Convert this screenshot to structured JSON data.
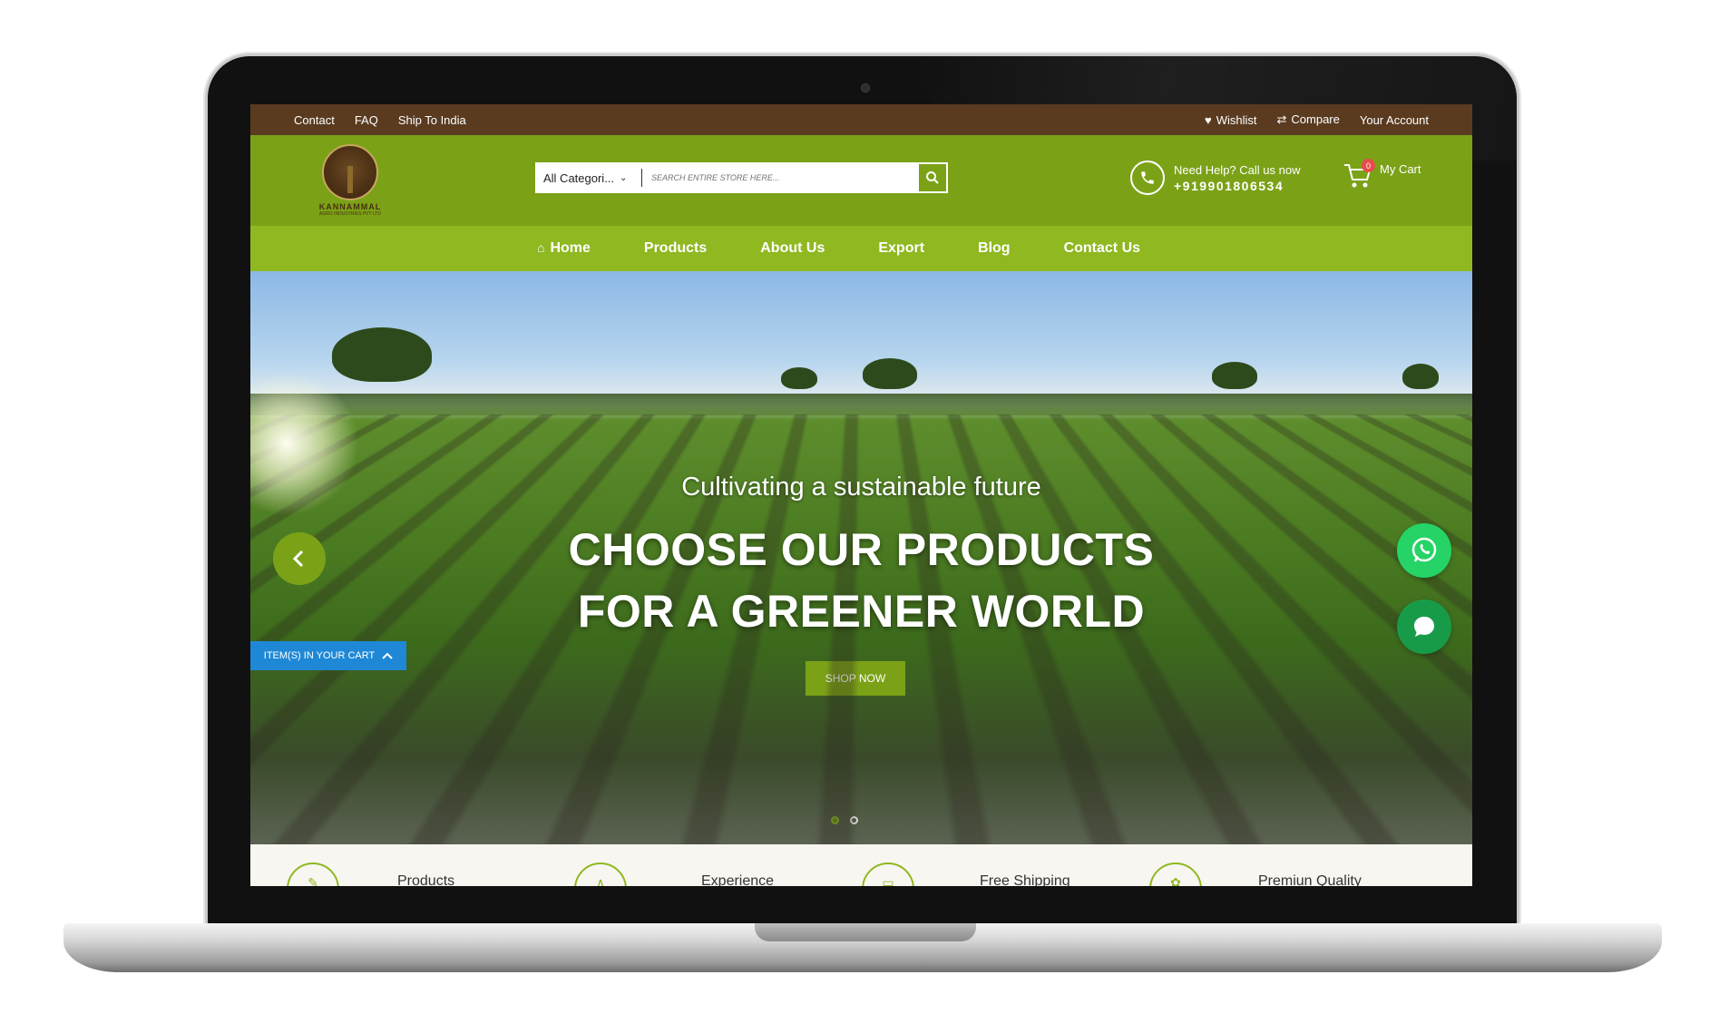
{
  "topbar": {
    "links": [
      "Contact",
      "FAQ",
      "Ship To India"
    ],
    "wishlist": "Wishlist",
    "compare": "Compare",
    "account": "Your Account"
  },
  "brand": {
    "name": "KANNAMMAL",
    "tagline": "AGRO INDUSTRIES PVT LTD"
  },
  "search": {
    "category": "All Categori...",
    "placeholder": "SEARCH ENTIRE STORE HERE..."
  },
  "help": {
    "label": "Need Help? Call us now",
    "phone": "+919901806534"
  },
  "cart": {
    "label": "My Cart",
    "count": "0",
    "tab_label": "ITEM(S) IN YOUR CART"
  },
  "nav": [
    "Home",
    "Products",
    "About Us",
    "Export",
    "Blog",
    "Contact Us"
  ],
  "hero": {
    "subtitle": "Cultivating a sustainable future",
    "line1": "CHOOSE OUR PRODUCTS",
    "line2": "FOR A GREENER WORLD",
    "cta": "SHOP NOW",
    "slide_count": 2,
    "active_slide": 1
  },
  "features": [
    "Products",
    "Experience",
    "Free Shipping",
    "Premiun Quality"
  ],
  "colors": {
    "topbar": "#5a3b20",
    "header": "#7ba217",
    "nav": "#8fb821",
    "cart_tab": "#1f88d6",
    "whatsapp": "#25d366"
  }
}
